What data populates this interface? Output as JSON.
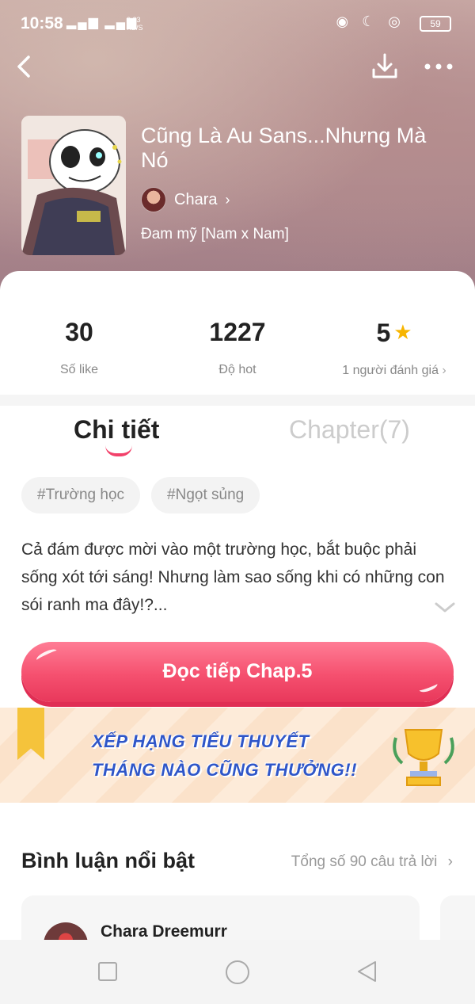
{
  "status_bar": {
    "time": "10:58",
    "signal": "▂▄▆ ▂▄▆",
    "speed_value": "0.23",
    "speed_unit": "KB/S",
    "icons": "◉ ☾ ◎",
    "battery": "59"
  },
  "book": {
    "title": "Cũng Là Au Sans...Nhưng Mà Nó",
    "author": "Chara",
    "genre": "Đam mỹ [Nam x Nam]"
  },
  "stats": [
    {
      "value": "30",
      "label": "Số like"
    },
    {
      "value": "1227",
      "label": "Độ hot"
    },
    {
      "value": "5",
      "label": "1 người đánh giá"
    }
  ],
  "tabs": {
    "detail": "Chi tiết",
    "chapter": "Chapter(7)"
  },
  "tags": [
    "#Trường học",
    "#Ngọt sủng"
  ],
  "description": "Cả đám được mời vào một trường học, bắt buộc phải sống xót tới sáng! Nhưng làm sao sống khi có những con sói ranh ma đây!?...",
  "read_button": "Đọc tiếp Chap.5",
  "banner": {
    "line1": "XẾP HẠNG TIỂU THUYẾT",
    "line2": "THÁNG NÀO CŨNG THƯỞNG!!"
  },
  "comments": {
    "heading": "Bình luận nổi bật",
    "count_label": "Tổng số 90 câu trả lời",
    "first_user": "Chara Dreemurr"
  },
  "colors": {
    "accent": "#f2416a",
    "star": "#f7b500",
    "banner_text": "#2f56c8"
  }
}
